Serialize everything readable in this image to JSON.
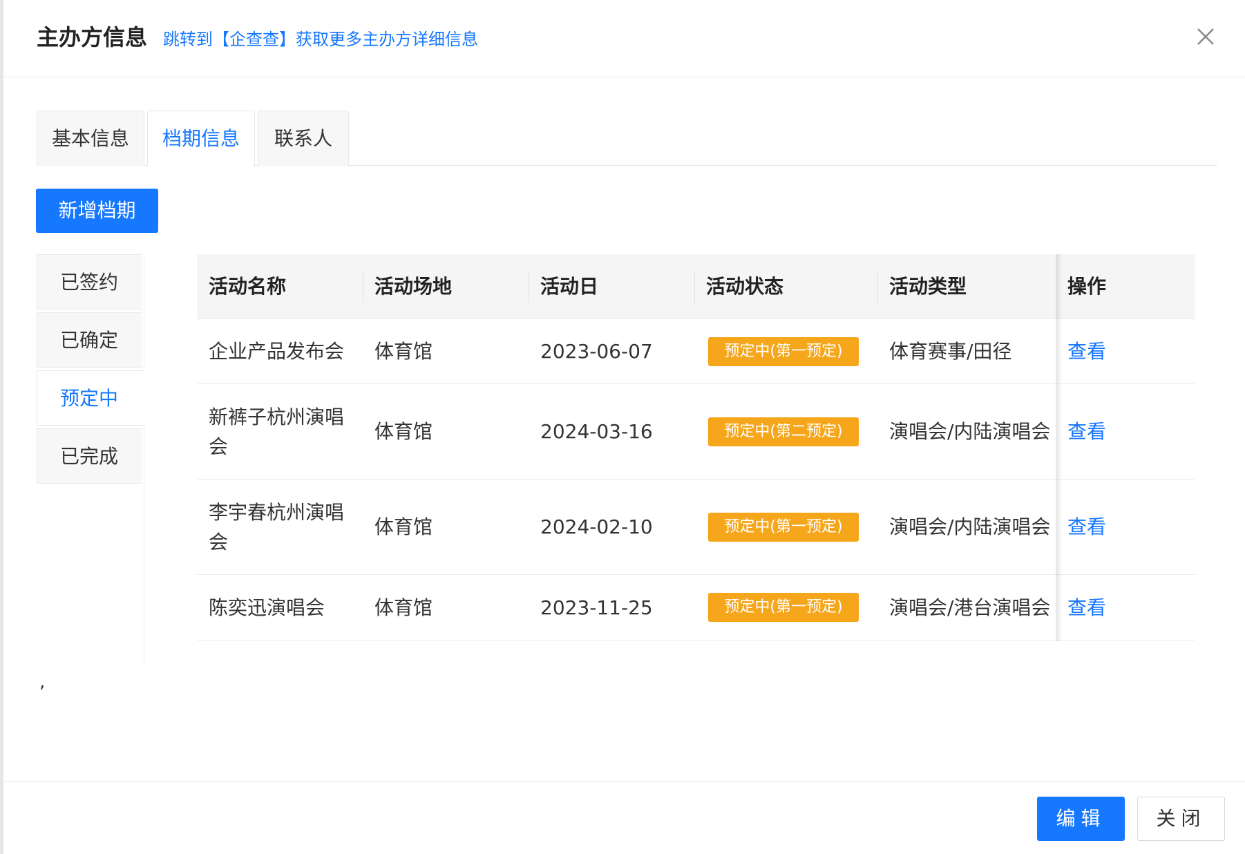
{
  "dialog": {
    "title": "主办方信息",
    "title_link": "跳转到【企查查】获取更多主办方详细信息"
  },
  "tabs": [
    {
      "label": "基本信息",
      "active": false
    },
    {
      "label": "档期信息",
      "active": true
    },
    {
      "label": "联系人",
      "active": false
    }
  ],
  "add_button": "新增档期",
  "status_tabs": [
    {
      "label": "已签约",
      "active": false
    },
    {
      "label": "已确定",
      "active": false
    },
    {
      "label": "预定中",
      "active": true
    },
    {
      "label": "已完成",
      "active": false
    }
  ],
  "table": {
    "headers": [
      "活动名称",
      "活动场地",
      "活动日",
      "活动状态",
      "活动类型",
      "操作"
    ],
    "rows": [
      {
        "name": "企业产品发布会",
        "venue": "体育馆",
        "date": "2023-06-07",
        "status": "预定中(第一预定)",
        "type": "体育赛事/田径",
        "action": "查看"
      },
      {
        "name": "新裤子杭州演唱会",
        "venue": "体育馆",
        "date": "2024-03-16",
        "status": "预定中(第二预定)",
        "type": "演唱会/内陆演唱会",
        "action": "查看"
      },
      {
        "name": "李宇春杭州演唱会",
        "venue": "体育馆",
        "date": "2024-02-10",
        "status": "预定中(第一预定)",
        "type": "演唱会/内陆演唱会",
        "action": "查看"
      },
      {
        "name": "陈奕迅演唱会",
        "venue": "体育馆",
        "date": "2023-11-25",
        "status": "预定中(第一预定)",
        "type": "演唱会/港台演唱会",
        "action": "查看"
      }
    ]
  },
  "stray_text": ",",
  "footer": {
    "edit_label": "编辑",
    "close_label": "关闭"
  },
  "colors": {
    "primary": "#1677ff",
    "badge": "#f5a61b"
  }
}
